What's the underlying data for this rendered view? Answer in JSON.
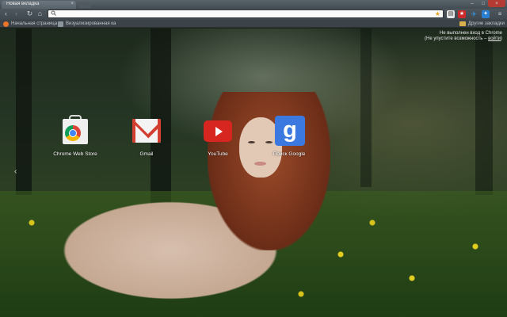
{
  "window": {
    "tab_title": "Новая вкладка",
    "tab_close": "×",
    "controls": {
      "minimize": "–",
      "maximize": "□",
      "close": "×"
    }
  },
  "toolbar": {
    "back_icon": "‹",
    "forward_icon": "›",
    "reload_icon": "↻",
    "home_icon": "⌂",
    "omnibox_value": "",
    "omnibox_placeholder": "",
    "star_icon": "★",
    "menu_icon": "≡",
    "extensions": [
      {
        "name": "extension-1-icon",
        "glyph": "▤"
      },
      {
        "name": "extension-2-icon",
        "glyph": "★"
      },
      {
        "name": "extension-3-icon",
        "glyph": "✈"
      },
      {
        "name": "extension-4-icon",
        "glyph": "✦"
      }
    ]
  },
  "bookmarks": {
    "items": [
      {
        "label": "Начальная страница"
      },
      {
        "label": "Визуализированная ка"
      }
    ],
    "other_label": "Другие закладки"
  },
  "signin": {
    "line1": "Не выполнен вход в Chrome",
    "line2_prefix": "(Не упустите возможность – ",
    "link": "войти",
    "line2_suffix": ")"
  },
  "apps": [
    {
      "label": "Chrome Web Store"
    },
    {
      "label": "Gmail"
    },
    {
      "label": "YouTube"
    },
    {
      "label": "Поиск Google"
    }
  ],
  "page_arrow": "‹",
  "colors": {
    "close_button": "#b33b33",
    "gmail_red": "#d23f31",
    "youtube_red": "#d6261f",
    "google_blue": "#3b79e0",
    "star": "#e3a51d"
  }
}
